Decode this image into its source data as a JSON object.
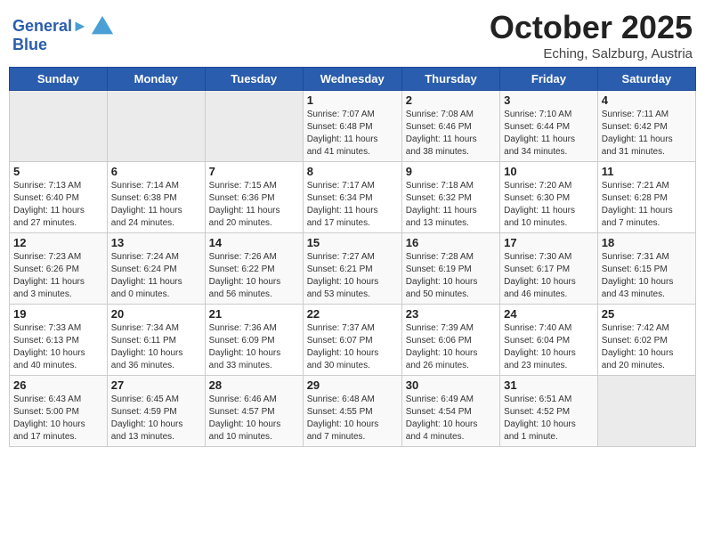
{
  "header": {
    "logo_line1": "General",
    "logo_line2": "Blue",
    "month": "October 2025",
    "location": "Eching, Salzburg, Austria"
  },
  "weekdays": [
    "Sunday",
    "Monday",
    "Tuesday",
    "Wednesday",
    "Thursday",
    "Friday",
    "Saturday"
  ],
  "weeks": [
    [
      {
        "day": "",
        "info": ""
      },
      {
        "day": "",
        "info": ""
      },
      {
        "day": "",
        "info": ""
      },
      {
        "day": "1",
        "info": "Sunrise: 7:07 AM\nSunset: 6:48 PM\nDaylight: 11 hours\nand 41 minutes."
      },
      {
        "day": "2",
        "info": "Sunrise: 7:08 AM\nSunset: 6:46 PM\nDaylight: 11 hours\nand 38 minutes."
      },
      {
        "day": "3",
        "info": "Sunrise: 7:10 AM\nSunset: 6:44 PM\nDaylight: 11 hours\nand 34 minutes."
      },
      {
        "day": "4",
        "info": "Sunrise: 7:11 AM\nSunset: 6:42 PM\nDaylight: 11 hours\nand 31 minutes."
      }
    ],
    [
      {
        "day": "5",
        "info": "Sunrise: 7:13 AM\nSunset: 6:40 PM\nDaylight: 11 hours\nand 27 minutes."
      },
      {
        "day": "6",
        "info": "Sunrise: 7:14 AM\nSunset: 6:38 PM\nDaylight: 11 hours\nand 24 minutes."
      },
      {
        "day": "7",
        "info": "Sunrise: 7:15 AM\nSunset: 6:36 PM\nDaylight: 11 hours\nand 20 minutes."
      },
      {
        "day": "8",
        "info": "Sunrise: 7:17 AM\nSunset: 6:34 PM\nDaylight: 11 hours\nand 17 minutes."
      },
      {
        "day": "9",
        "info": "Sunrise: 7:18 AM\nSunset: 6:32 PM\nDaylight: 11 hours\nand 13 minutes."
      },
      {
        "day": "10",
        "info": "Sunrise: 7:20 AM\nSunset: 6:30 PM\nDaylight: 11 hours\nand 10 minutes."
      },
      {
        "day": "11",
        "info": "Sunrise: 7:21 AM\nSunset: 6:28 PM\nDaylight: 11 hours\nand 7 minutes."
      }
    ],
    [
      {
        "day": "12",
        "info": "Sunrise: 7:23 AM\nSunset: 6:26 PM\nDaylight: 11 hours\nand 3 minutes."
      },
      {
        "day": "13",
        "info": "Sunrise: 7:24 AM\nSunset: 6:24 PM\nDaylight: 11 hours\nand 0 minutes."
      },
      {
        "day": "14",
        "info": "Sunrise: 7:26 AM\nSunset: 6:22 PM\nDaylight: 10 hours\nand 56 minutes."
      },
      {
        "day": "15",
        "info": "Sunrise: 7:27 AM\nSunset: 6:21 PM\nDaylight: 10 hours\nand 53 minutes."
      },
      {
        "day": "16",
        "info": "Sunrise: 7:28 AM\nSunset: 6:19 PM\nDaylight: 10 hours\nand 50 minutes."
      },
      {
        "day": "17",
        "info": "Sunrise: 7:30 AM\nSunset: 6:17 PM\nDaylight: 10 hours\nand 46 minutes."
      },
      {
        "day": "18",
        "info": "Sunrise: 7:31 AM\nSunset: 6:15 PM\nDaylight: 10 hours\nand 43 minutes."
      }
    ],
    [
      {
        "day": "19",
        "info": "Sunrise: 7:33 AM\nSunset: 6:13 PM\nDaylight: 10 hours\nand 40 minutes."
      },
      {
        "day": "20",
        "info": "Sunrise: 7:34 AM\nSunset: 6:11 PM\nDaylight: 10 hours\nand 36 minutes."
      },
      {
        "day": "21",
        "info": "Sunrise: 7:36 AM\nSunset: 6:09 PM\nDaylight: 10 hours\nand 33 minutes."
      },
      {
        "day": "22",
        "info": "Sunrise: 7:37 AM\nSunset: 6:07 PM\nDaylight: 10 hours\nand 30 minutes."
      },
      {
        "day": "23",
        "info": "Sunrise: 7:39 AM\nSunset: 6:06 PM\nDaylight: 10 hours\nand 26 minutes."
      },
      {
        "day": "24",
        "info": "Sunrise: 7:40 AM\nSunset: 6:04 PM\nDaylight: 10 hours\nand 23 minutes."
      },
      {
        "day": "25",
        "info": "Sunrise: 7:42 AM\nSunset: 6:02 PM\nDaylight: 10 hours\nand 20 minutes."
      }
    ],
    [
      {
        "day": "26",
        "info": "Sunrise: 6:43 AM\nSunset: 5:00 PM\nDaylight: 10 hours\nand 17 minutes."
      },
      {
        "day": "27",
        "info": "Sunrise: 6:45 AM\nSunset: 4:59 PM\nDaylight: 10 hours\nand 13 minutes."
      },
      {
        "day": "28",
        "info": "Sunrise: 6:46 AM\nSunset: 4:57 PM\nDaylight: 10 hours\nand 10 minutes."
      },
      {
        "day": "29",
        "info": "Sunrise: 6:48 AM\nSunset: 4:55 PM\nDaylight: 10 hours\nand 7 minutes."
      },
      {
        "day": "30",
        "info": "Sunrise: 6:49 AM\nSunset: 4:54 PM\nDaylight: 10 hours\nand 4 minutes."
      },
      {
        "day": "31",
        "info": "Sunrise: 6:51 AM\nSunset: 4:52 PM\nDaylight: 10 hours\nand 1 minute."
      },
      {
        "day": "",
        "info": ""
      }
    ]
  ]
}
